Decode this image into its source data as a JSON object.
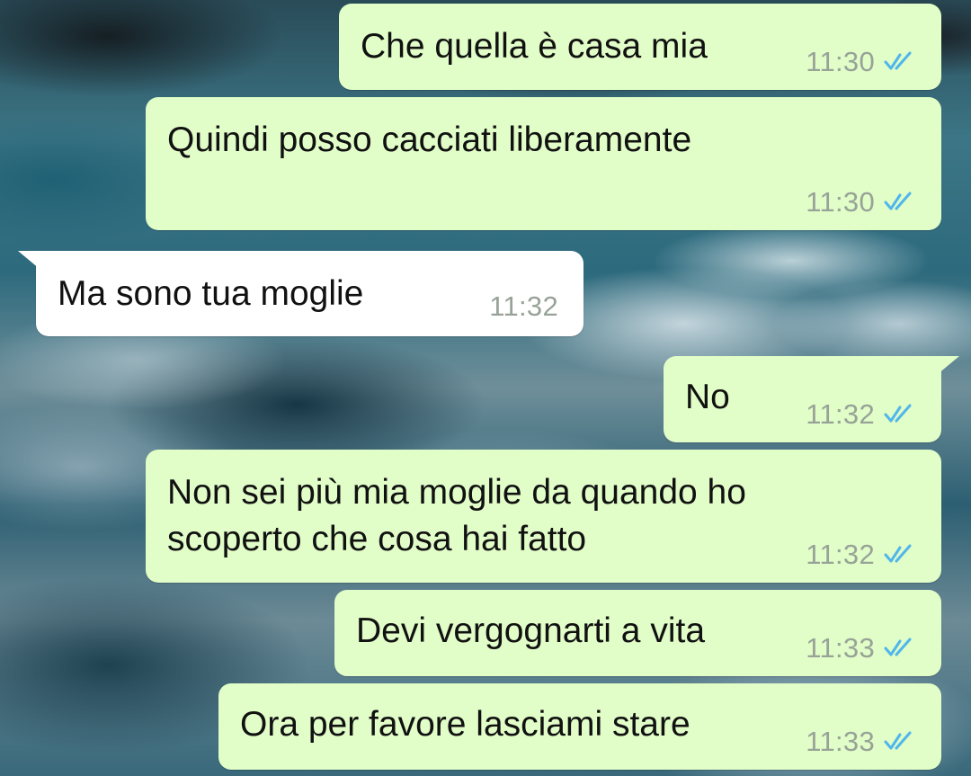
{
  "chat": {
    "accent_sent_bubble": "#e1fdc8",
    "accent_received_bubble": "#ffffff",
    "read_tick_color": "#4fb6ec",
    "messages": [
      {
        "direction": "outgoing",
        "text": "Che quella è casa mia",
        "time": "11:30",
        "status": "read-double-tick-icon"
      },
      {
        "direction": "outgoing",
        "text": "Quindi posso cacciati liberamente",
        "time": "11:30",
        "status": "read-double-tick-icon"
      },
      {
        "direction": "incoming",
        "text": "Ma sono tua moglie",
        "time": "11:32"
      },
      {
        "direction": "outgoing",
        "text": "No",
        "time": "11:32",
        "status": "read-double-tick-icon"
      },
      {
        "direction": "outgoing",
        "text": "Non sei più mia moglie da quando ho\nscoperto che cosa hai fatto",
        "time": "11:32",
        "status": "read-double-tick-icon"
      },
      {
        "direction": "outgoing",
        "text": "Devi vergognarti a vita",
        "time": "11:33",
        "status": "read-double-tick-icon"
      },
      {
        "direction": "outgoing",
        "text": "Ora per favore lasciami stare",
        "time": "11:33",
        "status": "read-double-tick-icon"
      }
    ]
  }
}
